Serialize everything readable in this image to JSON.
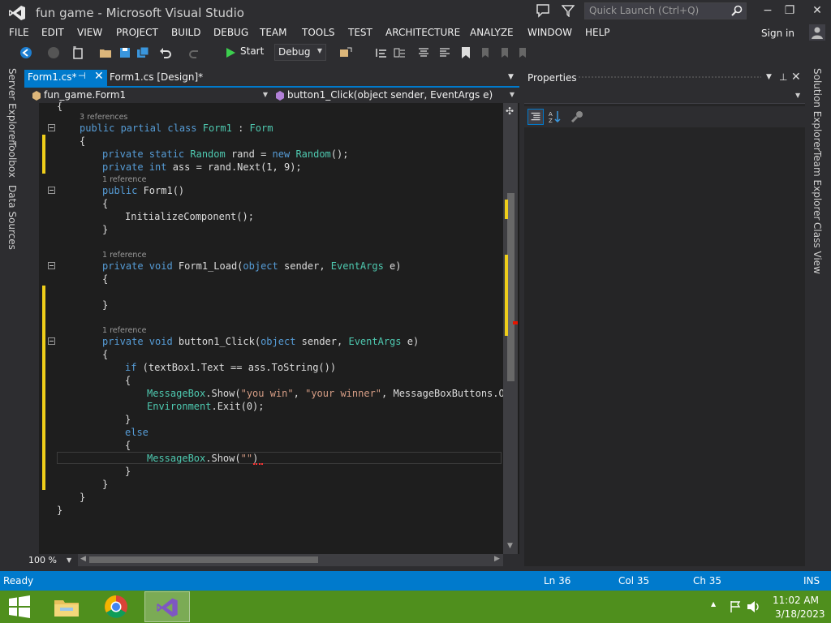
{
  "window": {
    "title": "fun game - Microsoft Visual Studio",
    "quick_launch_placeholder": "Quick Launch (Ctrl+Q)",
    "minimize": "−",
    "restore": "❐",
    "close": "✕"
  },
  "menu": [
    "FILE",
    "EDIT",
    "VIEW",
    "PROJECT",
    "BUILD",
    "DEBUG",
    "TEAM",
    "TOOLS",
    "TEST",
    "ARCHITECTURE",
    "ANALYZE",
    "WINDOW",
    "HELP"
  ],
  "account": {
    "sign_in": "Sign in"
  },
  "toolbar": {
    "start_label": "Start",
    "configuration": "Debug"
  },
  "left_tabs": [
    "Server Explorer",
    "Toolbox",
    "Data Sources"
  ],
  "right_tabs": [
    "Solution Explorer",
    "Team Explorer",
    "Class View"
  ],
  "doc_tabs": [
    {
      "label": "Form1.cs*",
      "active": true
    },
    {
      "label": "Form1.cs [Design]*",
      "active": false
    }
  ],
  "nav": {
    "type": "fun_game.Form1",
    "member": "button1_Click(object sender, EventArgs e)"
  },
  "code": {
    "line0": "{",
    "refs0": "3 references",
    "class_mod": "public partial class ",
    "class_name": "Form1",
    "class_sep": " : ",
    "class_base": "Form",
    "brace_open": "{",
    "brace_close": "}",
    "f1_mod": "private static ",
    "f1_type": "Random",
    "f1_mid": " rand = ",
    "f1_new": "new ",
    "f1_type2": "Random",
    "f1_end": "();",
    "f2_mod": "private int",
    "f2_rest": " ass = rand.Next(1, 9);",
    "refs1": "1 reference",
    "ctor_mod": "public ",
    "ctor_name": "Form1()",
    "ctor_body": "InitializeComponent();",
    "refs2": "1 reference",
    "load_mod": "private void ",
    "load_name": "Form1_Load(",
    "load_obj": "object",
    "load_mid": " sender, ",
    "load_ea": "EventArgs",
    "load_end": " e)",
    "refs3": "1 reference",
    "click_mod": "private void ",
    "click_name": "button1_Click(",
    "click_obj": "object",
    "click_mid": " sender, ",
    "click_ea": "EventArgs",
    "click_end": " e)",
    "if_kw": "if",
    "if_rest": " (textBox1.Text == ass.ToString())",
    "mb1_type": "MessageBox",
    "mb1_a": ".Show(",
    "mb1_s1": "\"you win\"",
    "mb1_b": ", ",
    "mb1_s2": "\"your winner\"",
    "mb1_c": ", MessageBoxButtons.OK,",
    "env_type": "Environment",
    "env_rest": ".Exit(0);",
    "else_kw": "else",
    "mb2_type": "MessageBox",
    "mb2_a": ".Show(",
    "mb2_s": "\"\"",
    "mb2_end": ")"
  },
  "editor": {
    "zoom": "100 %"
  },
  "properties": {
    "title": "Properties"
  },
  "status": {
    "ready": "Ready",
    "line": "Ln 36",
    "col": "Col 35",
    "ch": "Ch 35",
    "mode": "INS"
  },
  "taskbar": {
    "time": "11:02 AM",
    "date": "3/18/2023"
  },
  "colors": {
    "accent": "#007acc",
    "taskbar": "#4f8f1d",
    "keyword": "#569cd6",
    "type": "#4ec9b0",
    "string": "#d69d85",
    "change_marker": "#efce1a"
  }
}
